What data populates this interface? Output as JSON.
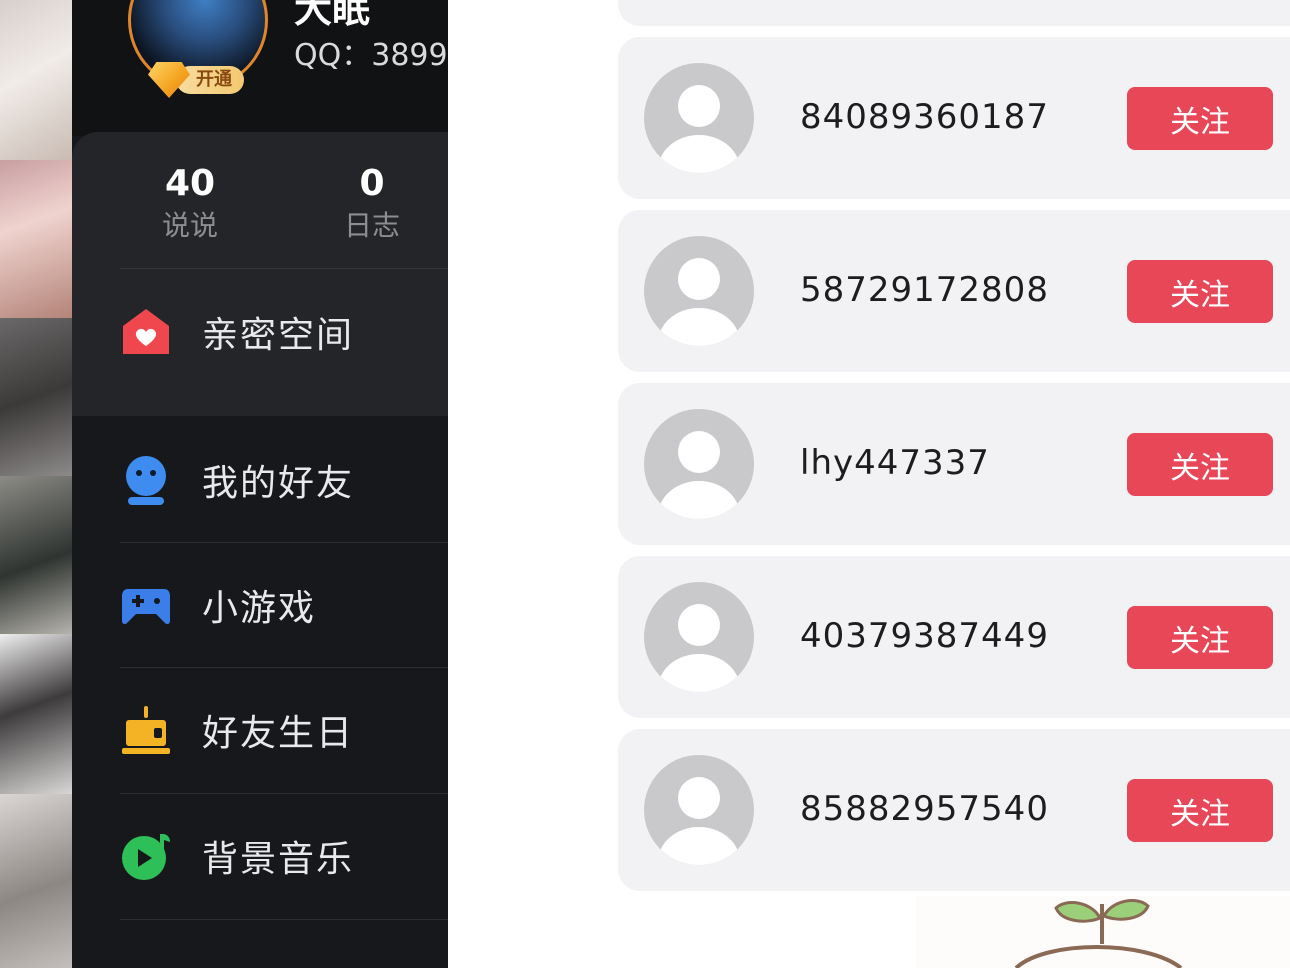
{
  "profile": {
    "name": "大眠",
    "qq": "QQ：3899",
    "vip_badge_label": "开通"
  },
  "stats": [
    {
      "value": "40",
      "label": "说说"
    },
    {
      "value": "0",
      "label": "日志"
    }
  ],
  "menu": [
    {
      "label": "亲密空间",
      "icon": "intimate-home-icon",
      "color": "#f0474f"
    },
    {
      "label": "我的好友",
      "icon": "friend-face-icon",
      "color": "#3f8cf0"
    },
    {
      "label": "小游戏",
      "icon": "gamepad-icon",
      "color": "#3b7de9"
    },
    {
      "label": "好友生日",
      "icon": "birthday-cake-icon",
      "color": "#f4b325"
    },
    {
      "label": "背景音乐",
      "icon": "music-disc-icon",
      "color": "#2fbf59"
    }
  ],
  "friends": [
    {
      "name": "84089360187",
      "action": "关注"
    },
    {
      "name": "58729172808",
      "action": "关注"
    },
    {
      "name": "lhy447337",
      "action": "关注"
    },
    {
      "name": "40379387449",
      "action": "关注"
    },
    {
      "name": "85882957540",
      "action": "关注"
    }
  ],
  "colors": {
    "follow_button": "#e84758",
    "drawer_background": "#16181b",
    "card_background": "#f2f2f4"
  }
}
